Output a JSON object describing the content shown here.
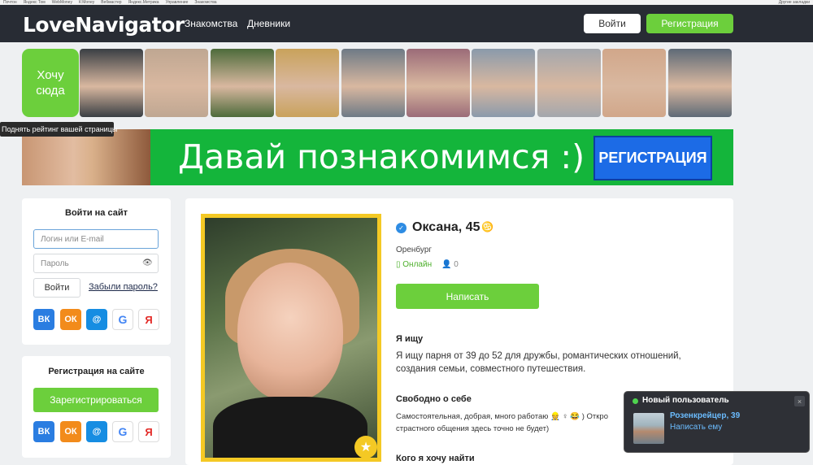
{
  "bookmarks": [
    "Почтон",
    "Яндекс Том",
    "WebMoney",
    "К:Money",
    "Вебмастер",
    "Яндекс.Метрика",
    "Управление",
    "Знакомства"
  ],
  "bookmarks_right": "Другие закладки",
  "header": {
    "logo": "LoveNavigator",
    "nav": [
      "Знакомства",
      "Дневники"
    ],
    "login_label": "Войти",
    "register_label": "Регистрация"
  },
  "strip": {
    "want_label": "Хочу сюда",
    "tooltip": "Поднять рейтинг вашей страницы",
    "thumb_colors": [
      "#3a3f44",
      "#bfa792",
      "#4d6b3b",
      "#c9a25b",
      "#6e7a86",
      "#9b6b78",
      "#8a9aab",
      "#a3a7ad",
      "#d1a78a",
      "#5e6a77"
    ]
  },
  "banner": {
    "text": "Давай познакомимся :)",
    "button": "РЕГИСТРАЦИЯ"
  },
  "login_card": {
    "title": "Войти на сайт",
    "login_placeholder": "Логин или E-mail",
    "password_placeholder": "Пароль",
    "submit": "Войти",
    "forgot": "Забыли пароль?",
    "social": [
      "ВК",
      "ОК",
      "@",
      "G",
      "Я"
    ]
  },
  "register_card": {
    "title": "Регистрация на сайте",
    "button": "Зарегистрироваться",
    "social": [
      "ВК",
      "ОК",
      "@",
      "G",
      "Я"
    ]
  },
  "profile": {
    "name": "Оксана, 45",
    "zodiac": "♋",
    "city": "Оренбург",
    "status": "Онлайн",
    "views": "0",
    "write_button": "Написать",
    "seeking_title": "Я ищу",
    "seeking_text": "Я ищу парня от 39 до 52 для дружбы, романтических отношений, создания семьи, совместного путешествия.",
    "about_title": "Свободно о себе",
    "about_text": "Самостоятельная, добрая, много работаю 👷 ♀ 😂 ) Откро",
    "about_text2": "страстного общения здесь точно не будет)",
    "want_title": "Кого я хочу найти"
  },
  "notification": {
    "title": "Новый пользователь",
    "close": "×",
    "user": "Розенкрейцер, 39",
    "action": "Написать ему"
  }
}
